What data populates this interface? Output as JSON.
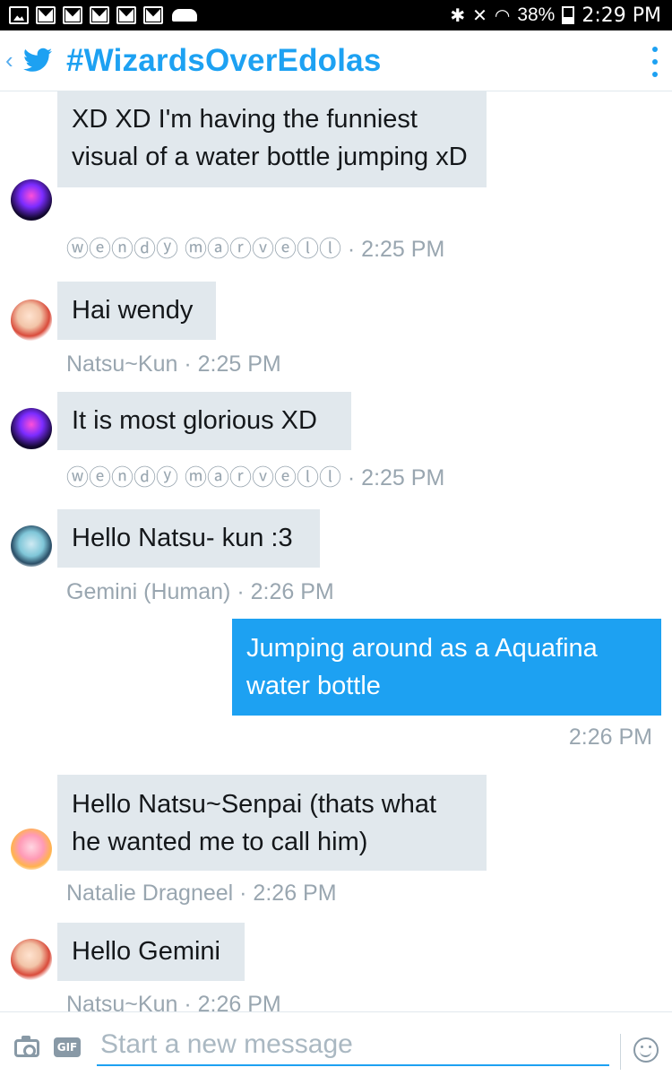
{
  "status_bar": {
    "battery": "38%",
    "time": "2:29 PM"
  },
  "header": {
    "title": "#WizardsOverEdolas"
  },
  "messages": [
    {
      "sender": "ⓦⓔⓝⓓⓨ ⓜⓐⓡⓥⓔⓛⓛ",
      "text": "XD XD I'm having the funniest visual of a water bottle jumping xD",
      "time": "2:25 PM",
      "meta": "ⓦⓔⓝⓓⓨ ⓜⓐⓡⓥⓔⓛⓛ · 2:25 PM"
    },
    {
      "sender": "Natsu~Kun",
      "text": "Hai wendy",
      "time": "2:25 PM",
      "meta": "Natsu~Kun · 2:25 PM"
    },
    {
      "sender": "ⓦⓔⓝⓓⓨ ⓜⓐⓡⓥⓔⓛⓛ",
      "text": "It is most glorious XD",
      "time": "2:25 PM",
      "meta": "ⓦⓔⓝⓓⓨ ⓜⓐⓡⓥⓔⓛⓛ · 2:25 PM"
    },
    {
      "sender": "Gemini (Human)",
      "text": "Hello Natsu- kun :3",
      "time": "2:26 PM",
      "meta": "Gemini (Human) · 2:26 PM"
    },
    {
      "sender": "",
      "text": "Jumping around as a Aquafina water bottle",
      "time": "2:26 PM",
      "meta": "2:26 PM",
      "own": true
    },
    {
      "sender": "Natalie Dragneel",
      "text": "Hello Natsu~Senpai (thats what he wanted me to call him)",
      "time": "2:26 PM",
      "meta": "Natalie Dragneel · 2:26 PM"
    },
    {
      "sender": "Natsu~Kun",
      "text": "Hello Gemini",
      "time": "2:26 PM",
      "meta": "Natsu~Kun · 2:26 PM"
    }
  ],
  "composer": {
    "placeholder": "Start a new message",
    "gif_label": "GIF"
  },
  "icons": {
    "back": "chevron-left-icon",
    "logo": "twitter-bird-icon",
    "menu": "kebab-menu-icon",
    "camera": "camera-icon",
    "gif": "gif-icon",
    "emoji": "emoji-icon"
  },
  "colors": {
    "accent": "#1da1f2",
    "incoming_bubble": "#e1e8ed",
    "meta_text": "#99a6b0"
  }
}
